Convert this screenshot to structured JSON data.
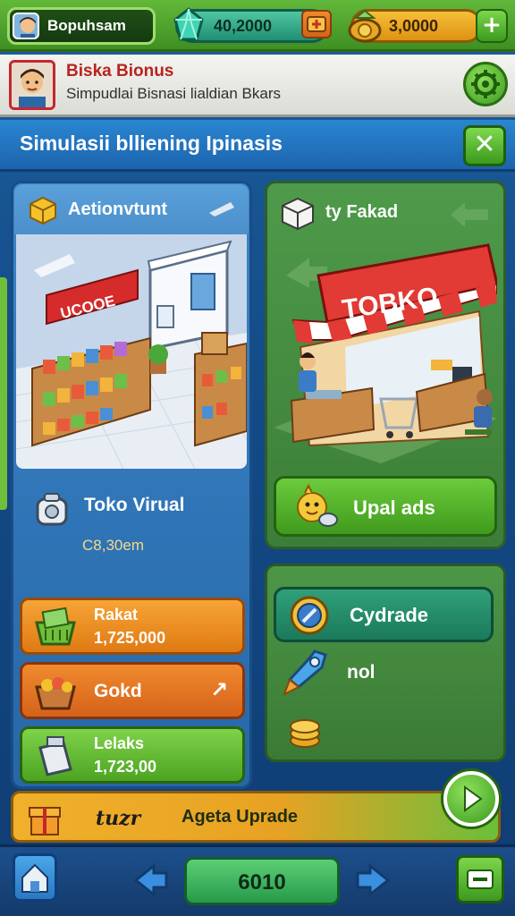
{
  "hud": {
    "username": "Bopuhsam",
    "gems": "40,2000",
    "coins": "3,0000",
    "plus_label": "+"
  },
  "profile": {
    "title": "Biska Bionus",
    "subtitle": "Simpudlai Bisnasi lialdian Bkars"
  },
  "section": {
    "title": "Simulasii blliening Ipinasis",
    "close_label": "✕"
  },
  "left_card": {
    "header": "Aetionvtunt",
    "store_sign": "UCOOE",
    "name": "Toko Virual",
    "value": "C8,30em",
    "stats": [
      {
        "label": "Rakat",
        "value": "1,725,000"
      },
      {
        "label": "Gokd",
        "value": ""
      },
      {
        "label": "Lelaks",
        "value": "1,723,00"
      }
    ],
    "gold_arrow": "↗"
  },
  "right_card": {
    "header": "ty Fakad",
    "store_sign": "TOBKO",
    "upload_label": "Upal ads",
    "upgrade_label": "Cydrade",
    "nol_label": "nol"
  },
  "action_bar": {
    "tag": "tuzr",
    "label": "Ageta Uprade"
  },
  "bottom_nav": {
    "page": "6010"
  },
  "colors": {
    "hud_green": "#4fa62b",
    "panel_blue": "#2d74b8",
    "panel_green": "#468b41",
    "accent_orange": "#e8861e",
    "accent_red": "#c6262e"
  }
}
